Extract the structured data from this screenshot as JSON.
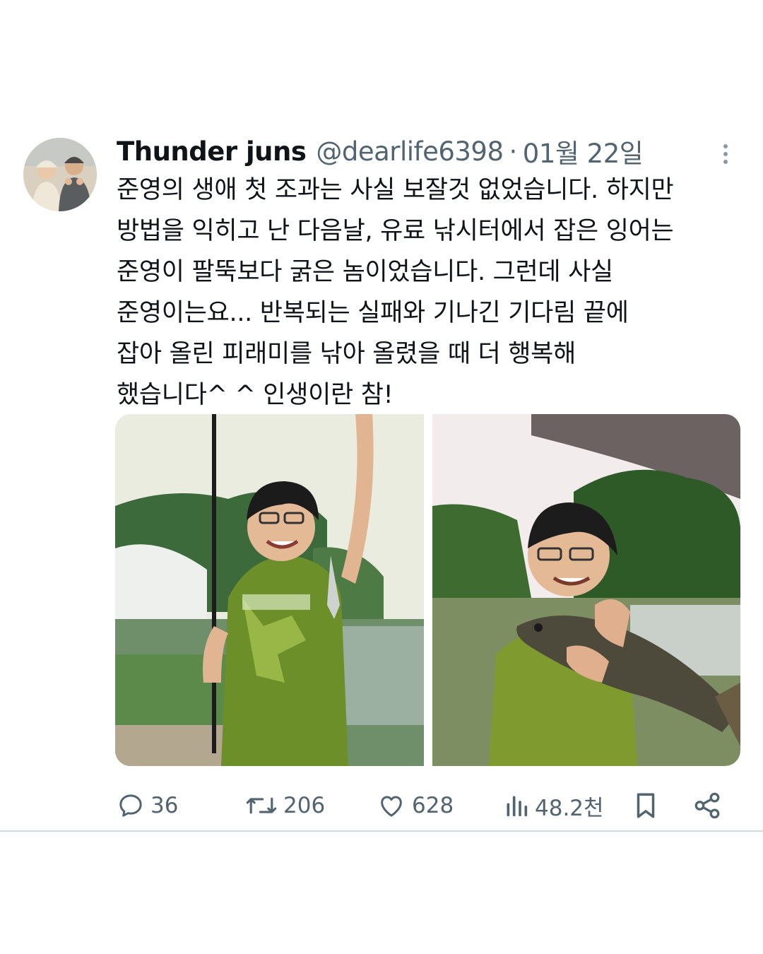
{
  "author": {
    "display_name": "Thunder juns",
    "handle": "@dearlife6398",
    "separator": "·",
    "date": "01월 22일"
  },
  "tweet": {
    "lines": [
      "준영의 생애 첫 조과는 사실 보잘것 없었습니다.  하지만",
      "방법을 익히고 난 다음날,  유료 낚시터에서  잡은 잉어는",
      "준영이 팔뚝보다 굵은 놈이었습니다. 그런데 사실",
      "준영이는요...  반복되는 실패와  기나긴 기다림 끝에",
      "잡아 올린 피래미를 낚아 올렸을 때 더 행복해",
      "했습니다^ ^ 인생이란 참!"
    ]
  },
  "actions": {
    "reply_count": "36",
    "retweet_count": "206",
    "like_count": "628",
    "view_count": "48.2천"
  },
  "icons": [
    "more-icon",
    "reply-icon",
    "retweet-icon",
    "like-icon",
    "views-icon",
    "bookmark-icon",
    "share-icon"
  ],
  "colors": {
    "text": "#0f1419",
    "secondary": "#536471",
    "divider": "#cfd9de"
  }
}
